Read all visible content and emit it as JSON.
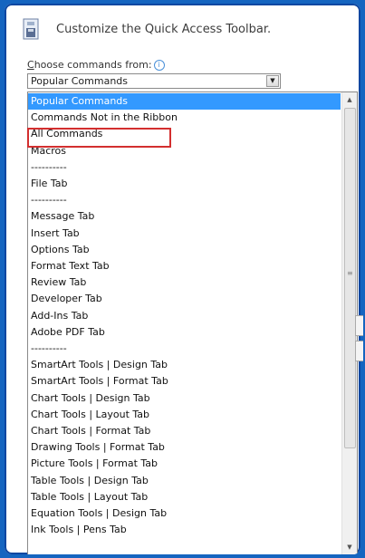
{
  "dialog": {
    "title": "Customize the Quick Access Toolbar.",
    "choose_label_underlined": "C",
    "choose_label_rest": "hoose commands from:",
    "info_glyph": "i",
    "dropdown_value": "Popular Commands"
  },
  "list": {
    "selected_index": 0,
    "highlighted_item": "All Commands",
    "items": [
      "Popular Commands",
      "Commands Not in the Ribbon",
      "All Commands",
      "Macros",
      "----------",
      "File Tab",
      "----------",
      "Message Tab",
      "Insert Tab",
      "Options Tab",
      "Format Text Tab",
      "Review Tab",
      "Developer Tab",
      "Add-Ins Tab",
      "Adobe PDF Tab",
      "----------",
      "SmartArt Tools | Design Tab",
      "SmartArt Tools | Format Tab",
      "Chart Tools | Design Tab",
      "Chart Tools | Layout Tab",
      "Chart Tools | Format Tab",
      "Drawing Tools | Format Tab",
      "Picture Tools | Format Tab",
      "Table Tools | Design Tab",
      "Table Tools | Layout Tab",
      "Equation Tools | Design Tab",
      "Ink Tools | Pens Tab"
    ]
  },
  "colors": {
    "selection": "#3399ff",
    "highlight_border": "#d32f2f",
    "frame": "#1565c0"
  }
}
